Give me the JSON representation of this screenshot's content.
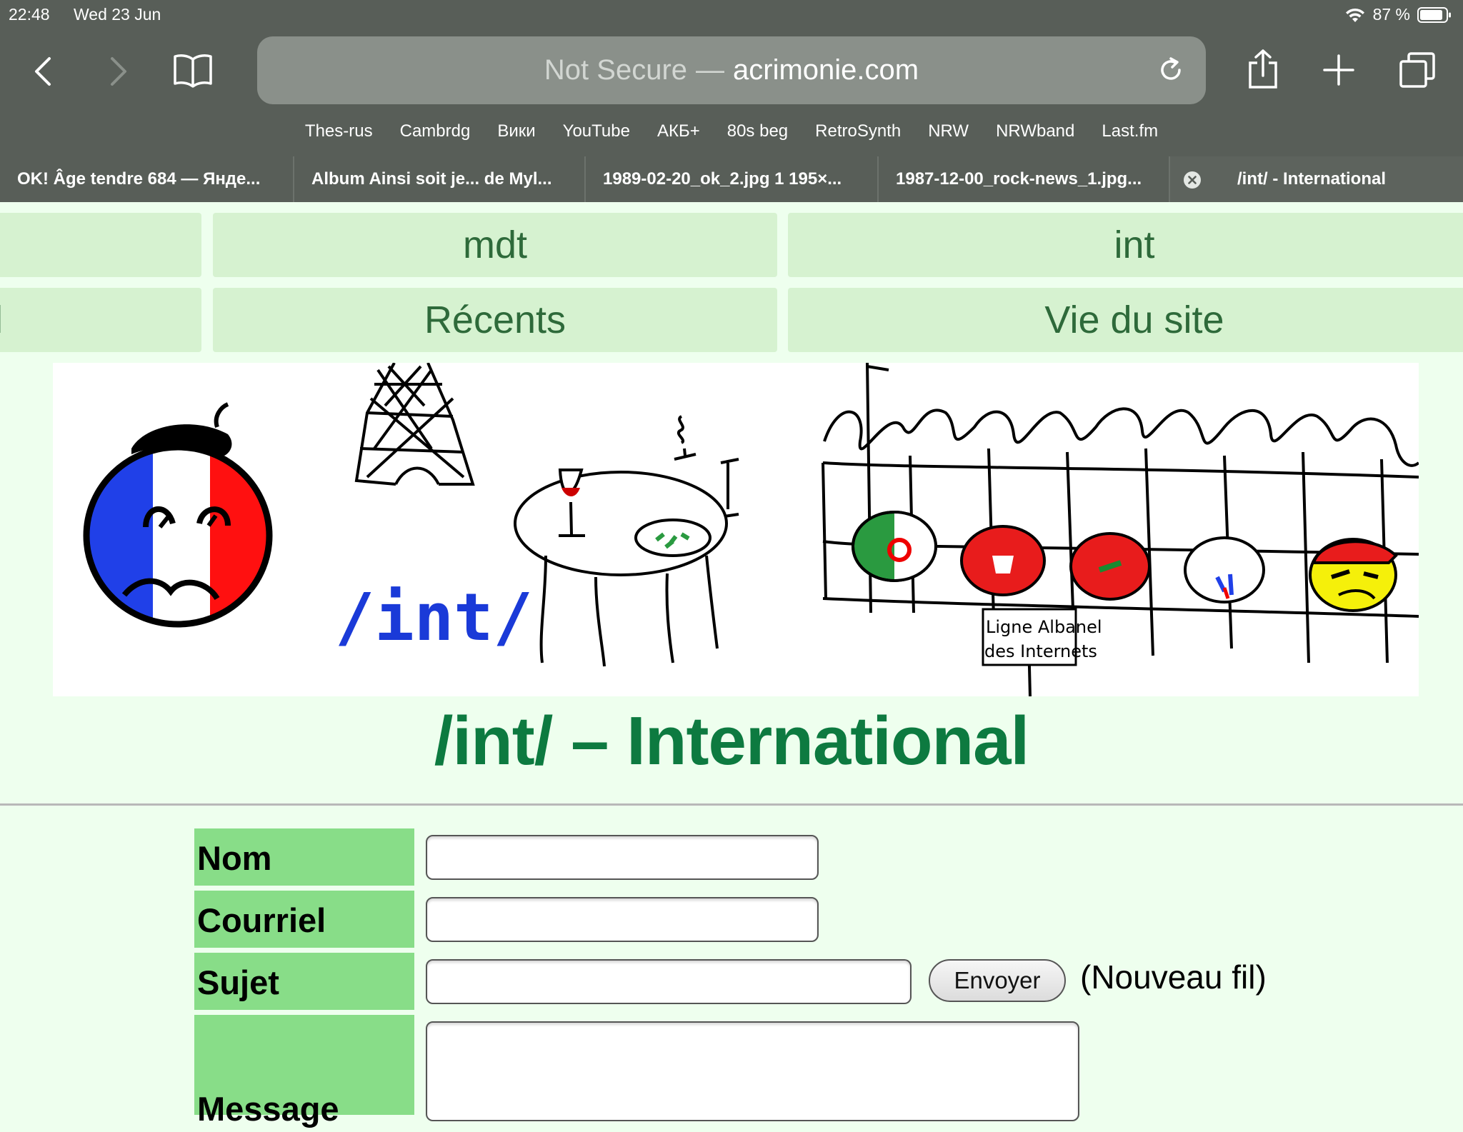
{
  "status": {
    "time": "22:48",
    "date": "Wed 23 Jun",
    "battery": "87 %"
  },
  "browser": {
    "address": {
      "security": "Not Secure",
      "separator": "—",
      "domain": "acrimonie.com"
    },
    "favorites": [
      "Thes-rus",
      "Cambrdg",
      "Вики",
      "YouTube",
      "АКБ+",
      "80s beg",
      "RetroSynth",
      "NRW",
      "NRWband",
      "Last.fm"
    ],
    "tabs": [
      {
        "title": "OK! Âge tendre 684 — Янде..."
      },
      {
        "title": "Album Ainsi soit je... de Myl..."
      },
      {
        "title": "1989-02-20_ok_2.jpg 1 195×..."
      },
      {
        "title": "1987-12-00_rock-news_1.jpg..."
      },
      {
        "title": "/int/ - International"
      }
    ],
    "icons": {
      "back": "chevron-left-icon",
      "forward": "chevron-right-icon",
      "bookmarks": "open-book-icon",
      "reload": "reload-icon",
      "share": "share-icon",
      "new_tab": "plus-icon",
      "tabs": "tabs-overview-icon",
      "close": "close-circle-icon"
    }
  },
  "nav": {
    "left_top": "",
    "mdt": "mdt",
    "int": "int",
    "left_bottom": "il",
    "recents": "Récents",
    "vie": "Vie du site"
  },
  "banner": {
    "board_tag": "/int/",
    "sign_line1": "Ligne Albanel",
    "sign_line2": "des Internets"
  },
  "board_title": "/int/ – International",
  "form": {
    "nom_label": "Nom",
    "courriel_label": "Courriel",
    "sujet_label": "Sujet",
    "message_label": "Message",
    "submit_label": "Envoyer",
    "new_thread_note": "(Nouveau fil)",
    "nom_value": "",
    "courriel_value": "",
    "sujet_value": "",
    "message_value": ""
  },
  "colors": {
    "chrome_bg": "#585e58",
    "page_bg": "#eeffee",
    "nav_bg": "#d6f2d0",
    "title_green": "#0d7a40",
    "label_bg": "#88dd88",
    "board_tag_blue": "#1a3ad8"
  }
}
